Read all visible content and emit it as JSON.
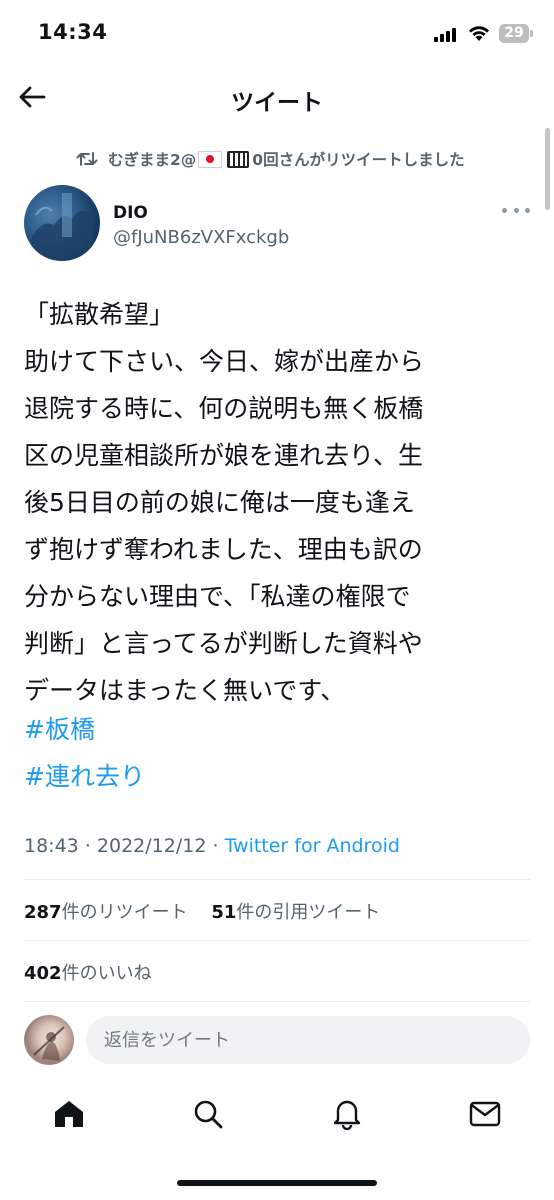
{
  "status_bar": {
    "time": "14:34",
    "battery": "29"
  },
  "header": {
    "title": "ツイート"
  },
  "retweet_context": {
    "text": "むぎまま2@",
    "text_after": "0回さんがリツイートしました"
  },
  "author": {
    "name": "DIO",
    "handle": "@fJuNB6zVXFxckgb"
  },
  "tweet": {
    "text": "「拡散希望」\n助けて下さい、今日、嫁が出産から\n退院する時に、何の説明も無く板橋\n区の児童相談所が娘を連れ去り、生\n後5日目の前の娘に俺は一度も逢え\nず抱けず奪われました、理由も訳の\n分からない理由で、「私達の権限で\n判断」と言ってるが判断した資料や\nデータはまったく無いです、",
    "hashtags": [
      "#板橋",
      "#連れ去り"
    ],
    "time": "18:43",
    "date": "2022/12/12",
    "separator": "·",
    "source": "Twitter for Android"
  },
  "stats": {
    "retweets": {
      "count": "287",
      "label": "件のリツイート"
    },
    "quotes": {
      "count": "51",
      "label": "件の引用ツイート"
    },
    "likes": {
      "count": "402",
      "label": "件のいいね"
    }
  },
  "reply": {
    "placeholder": "返信をツイート"
  },
  "bottom_nav": [
    "home-icon",
    "search-icon",
    "notifications-icon",
    "messages-icon"
  ],
  "colors": {
    "link": "#1d9bf0",
    "secondary_text": "#536471",
    "primary_text": "#0f1419"
  }
}
